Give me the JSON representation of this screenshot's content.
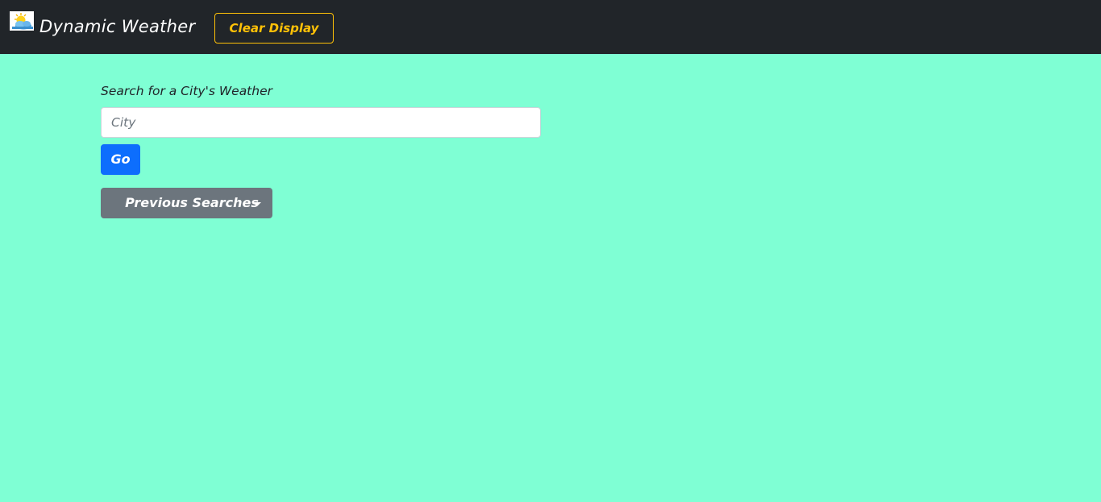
{
  "navbar": {
    "logo_icon": "partly-sunny-weather-icon",
    "brand_title": "Dynamic Weather",
    "clear_button_label": "Clear Display"
  },
  "search": {
    "label": "Search for a City's Weather",
    "input_value": "",
    "input_placeholder": "City",
    "go_button_label": "Go"
  },
  "previous_searches": {
    "button_label": "Previous Searches",
    "dropdown_icon": "caret-down-icon"
  },
  "colors": {
    "navbar_background": "#212529",
    "page_background": "#7fffd4",
    "clear_button": "#ffc107",
    "go_button": "#0d6efd",
    "previous_searches_button": "#6c757d"
  }
}
